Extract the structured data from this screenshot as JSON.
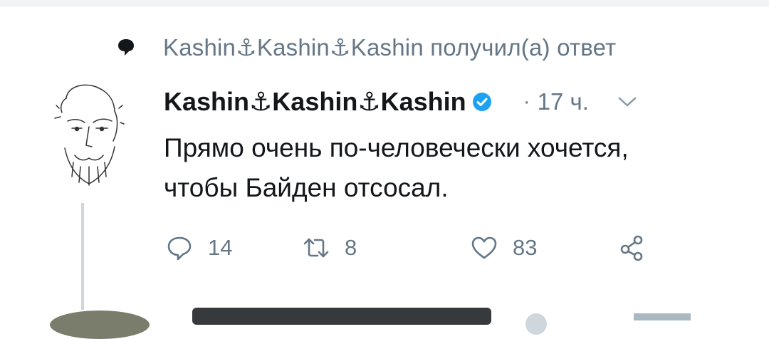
{
  "reply_context": {
    "text": "Kashin⚓Kashin⚓Kashin получил(а) ответ",
    "icon": "speech-bubble-icon"
  },
  "tweet": {
    "author_name": "Kashin⚓Kashin⚓Kashin",
    "verified": true,
    "separator": "·",
    "time": "17 ч.",
    "text": "Прямо очень по-человечески хочется,\nчтобы Байден отсосал.",
    "actions": {
      "reply_count": "14",
      "retweet_count": "8",
      "like_count": "83"
    }
  },
  "colors": {
    "text_primary": "#14171a",
    "text_secondary": "#657786",
    "verified_blue": "#1da1f2",
    "thread_line": "#ccd6dd"
  },
  "icons": [
    "speech-bubble-icon",
    "verified-badge-icon",
    "chevron-down-icon",
    "reply-icon",
    "retweet-icon",
    "heart-icon",
    "share-icon"
  ]
}
